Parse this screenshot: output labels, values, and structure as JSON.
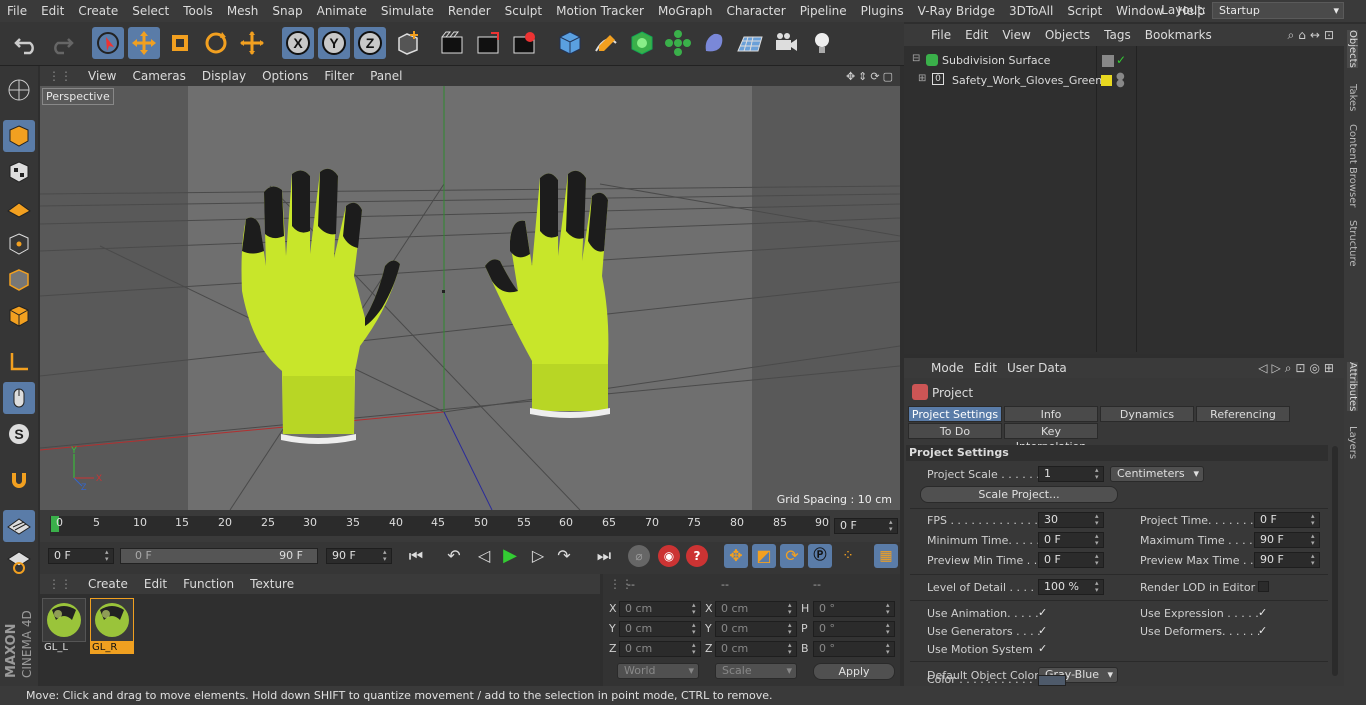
{
  "menubar": {
    "items": [
      "File",
      "Edit",
      "Create",
      "Select",
      "Tools",
      "Mesh",
      "Snap",
      "Animate",
      "Simulate",
      "Render",
      "Sculpt",
      "Motion Tracker",
      "MoGraph",
      "Character",
      "Pipeline",
      "Plugins",
      "V-Ray Bridge",
      "3DToAll",
      "Script",
      "Window",
      "Help"
    ],
    "layout_label": "Layout:",
    "layout_value": "Startup"
  },
  "viewport": {
    "menu": [
      "View",
      "Cameras",
      "Display",
      "Options",
      "Filter",
      "Panel"
    ],
    "camera_label": "Perspective",
    "grid_spacing": "Grid Spacing : 10 cm"
  },
  "timeline": {
    "ticks": [
      "0",
      "5",
      "10",
      "15",
      "20",
      "25",
      "30",
      "35",
      "40",
      "45",
      "50",
      "55",
      "60",
      "65",
      "70",
      "75",
      "80",
      "85",
      "90"
    ],
    "current_frame": "0 F"
  },
  "playbar": {
    "start_field": "0 F",
    "range_start": "0 F",
    "range_end": "90 F",
    "end_field": "90 F"
  },
  "materials": {
    "menu": [
      "Create",
      "Edit",
      "Function",
      "Texture"
    ],
    "items": [
      {
        "name": "GL_L",
        "selected": false
      },
      {
        "name": "GL_R",
        "selected": true
      }
    ]
  },
  "coordinates": {
    "headers": [
      "--",
      "--",
      "--"
    ],
    "rows": [
      {
        "a": "X",
        "av": "0 cm",
        "b": "X",
        "bv": "0 cm",
        "c": "H",
        "cv": "0 °"
      },
      {
        "a": "Y",
        "av": "0 cm",
        "b": "Y",
        "bv": "0 cm",
        "c": "P",
        "cv": "0 °"
      },
      {
        "a": "Z",
        "av": "0 cm",
        "b": "Z",
        "bv": "0 cm",
        "c": "B",
        "cv": "0 °"
      }
    ],
    "space": "World",
    "mode": "Scale",
    "apply": "Apply"
  },
  "objects": {
    "menu": [
      "File",
      "Edit",
      "View",
      "Objects",
      "Tags",
      "Bookmarks"
    ],
    "tree": [
      {
        "name": "Subdivision Surface",
        "level": 0
      },
      {
        "name": "Safety_Work_Gloves_Green",
        "level": 1
      }
    ]
  },
  "right_tabs": [
    "Objects",
    "Takes",
    "Content Browser",
    "Structure",
    "Attributes",
    "Layers"
  ],
  "attributes": {
    "menu": [
      "Mode",
      "Edit",
      "User Data"
    ],
    "object_title": "Project",
    "tabs_row1": [
      "Project Settings",
      "Info",
      "Dynamics",
      "Referencing"
    ],
    "tabs_row2": [
      "To Do",
      "Key Interpolation"
    ],
    "section_title": "Project Settings",
    "project_scale_label": "Project Scale . . . . . .",
    "project_scale_value": "1",
    "project_scale_unit": "Centimeters",
    "scale_project_button": "Scale Project...",
    "fps_label": "FPS . . . . . . . . . . . . . .",
    "fps_value": "30",
    "project_time_label": "Project Time. . . . . . . .",
    "project_time_value": "0 F",
    "min_time_label": "Minimum Time. . . . . .",
    "min_time_value": "0 F",
    "max_time_label": "Maximum Time . . . . .",
    "max_time_value": "90 F",
    "preview_min_label": "Preview Min Time . .",
    "preview_min_value": "0 F",
    "preview_max_label": "Preview Max Time . . .",
    "preview_max_value": "90 F",
    "lod_label": "Level of Detail . . . . .",
    "lod_value": "100 %",
    "render_lod_label": "Render LOD in Editor",
    "use_animation_label": "Use Animation. . . . .",
    "use_expression_label": "Use Expression . . . . .",
    "use_generators_label": "Use Generators . . . .",
    "use_deformers_label": "Use Deformers. . . . . .",
    "use_motion_label": "Use Motion System",
    "default_color_label": "Default Object Color",
    "default_color_value": "Gray-Blue",
    "color_label": "Color . . . . . . . . . . .",
    "check_glyph": "✓"
  },
  "status": "Move: Click and drag to move elements. Hold down SHIFT to quantize movement / add to the selection in point mode, CTRL to remove.",
  "brand": {
    "line1": "MAXON",
    "line2": "CINEMA 4D"
  },
  "colors": {
    "accent": "#5a7ca8",
    "glove_green": "#c8e62a",
    "glove_black": "#1c1c1c",
    "material_label_sel": "#f0a020"
  }
}
